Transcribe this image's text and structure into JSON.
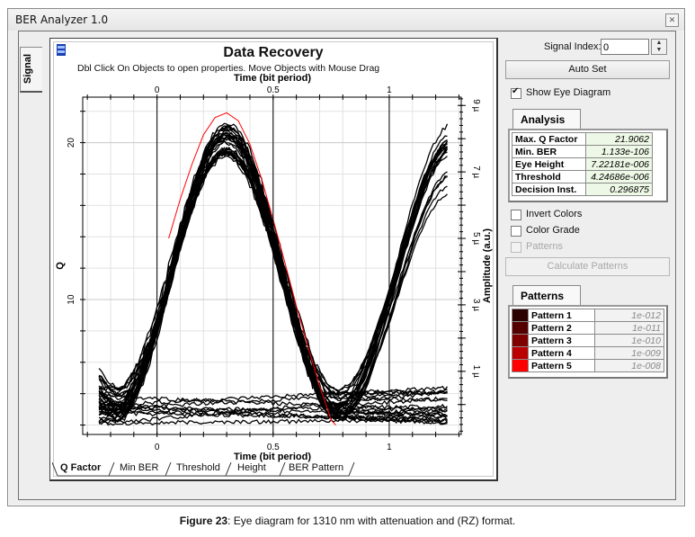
{
  "window": {
    "title": "BER Analyzer 1.0",
    "close_icon": "close-icon"
  },
  "side_tab": {
    "label": "Signal"
  },
  "plot_panel": {
    "icon": "panel-toggle-icon",
    "title": "Data Recovery",
    "hint": "Dbl Click On Objects to open properties.  Move Objects with Mouse Drag",
    "bottom_tabs": [
      {
        "label": "Q Factor",
        "active": true
      },
      {
        "label": "Min BER",
        "active": false
      },
      {
        "label": "Threshold",
        "active": false
      },
      {
        "label": "Height",
        "active": false
      },
      {
        "label": "BER Pattern",
        "active": false
      }
    ]
  },
  "controls": {
    "signal_index_label": "Signal Index:",
    "signal_index_value": "0",
    "auto_set_label": "Auto Set",
    "show_eye_label": "Show Eye Diagram",
    "show_eye_checked": true,
    "invert_colors_label": "Invert Colors",
    "invert_colors_checked": false,
    "color_grade_label": "Color Grade",
    "color_grade_checked": false,
    "patterns_label": "Patterns",
    "patterns_checked": false,
    "patterns_enabled": false,
    "calculate_patterns_label": "Calculate Patterns",
    "calculate_patterns_enabled": false
  },
  "analysis": {
    "tab_label": "Analysis",
    "rows": [
      {
        "key": "Max. Q Factor",
        "value": "21.9062"
      },
      {
        "key": "Min. BER",
        "value": "1.133e-106"
      },
      {
        "key": "Eye Height",
        "value": "7.22181e-006"
      },
      {
        "key": "Threshold",
        "value": "4.24686e-006"
      },
      {
        "key": "Decision Inst.",
        "value": "0.296875"
      }
    ]
  },
  "patterns": {
    "tab_label": "Patterns",
    "rows": [
      {
        "key": "Pattern 1",
        "value": "1e-012",
        "color": "#2a0000"
      },
      {
        "key": "Pattern 2",
        "value": "1e-011",
        "color": "#550000"
      },
      {
        "key": "Pattern 3",
        "value": "1e-010",
        "color": "#800000"
      },
      {
        "key": "Pattern 4",
        "value": "1e-009",
        "color": "#bb0000"
      },
      {
        "key": "Pattern 5",
        "value": "1e-008",
        "color": "#ff0000"
      }
    ]
  },
  "caption": {
    "figure": "Figure 23",
    "text": ": Eye diagram for 1310 nm with attenuation and (RZ) format."
  },
  "chart_data": {
    "type": "line",
    "title": "Data Recovery",
    "xlabel": "Time (bit period)",
    "ylabel_left": "Q",
    "ylabel_right": "Amplitude (a.u.)",
    "xlim": [
      -0.32,
      1.31
    ],
    "x_ticks": [
      0,
      0.5,
      1
    ],
    "x_tick_labels": [
      "0",
      "0.5",
      "1"
    ],
    "ylim_left": [
      1.4,
      22.9
    ],
    "y_left_ticks": [
      10,
      20
    ],
    "y_left_tick_labels": [
      "10",
      "20"
    ],
    "ylim_right": [
      -0.9,
      9.25
    ],
    "y_right_ticks": [
      1,
      3,
      5,
      7,
      9
    ],
    "y_right_tick_labels": [
      "1 µ",
      "3 µ",
      "5 µ",
      "7 µ",
      "9 µ"
    ],
    "grid": true,
    "eye_diagram": {
      "trace_color": "#000000",
      "num_traces": 40,
      "x_start": -0.25,
      "x_end": 1.25,
      "high_level_um": 8.3,
      "high_spread_um": 0.7,
      "low_level_um": -0.05,
      "low_spread_um": 0.55,
      "peak_time": 0.3,
      "second_peak_time_end": 1.25,
      "crossing_times": [
        -0.18,
        0.77
      ]
    },
    "q_factor_curve": {
      "color": "#ff0000",
      "x": [
        0.05,
        0.1,
        0.15,
        0.2,
        0.25,
        0.3,
        0.35,
        0.4,
        0.45,
        0.5,
        0.55,
        0.6,
        0.65,
        0.7,
        0.75,
        0.77
      ],
      "q": [
        13.9,
        16.4,
        18.6,
        20.5,
        21.6,
        21.9,
        21.4,
        19.9,
        17.7,
        15.1,
        12.4,
        9.6,
        7.0,
        4.5,
        2.3,
        2.0
      ]
    }
  }
}
